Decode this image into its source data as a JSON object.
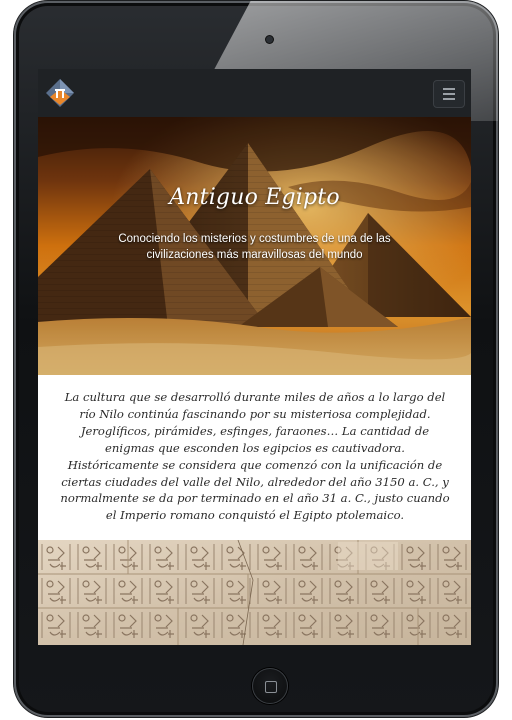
{
  "hero": {
    "title": "Antiguo Egipto",
    "subtitle": "Conociendo los misterios y costumbres de una de las civilizaciones más maravillosas del mundo"
  },
  "intro": {
    "text": "La cultura que se desarrolló durante miles de años a lo largo del río Nilo continúa fascinando por su misteriosa complejidad. Jeroglíficos, pirámides, esfinges, faraones… La cantidad de enigmas que esconden los egipcios es cautivadora. Históricamente se considera que comenzó con la unificación de ciertas ciudades del valle del Nilo, alrededor del año 3150 a. C., y normalmente se da por terminado en el año 31 a. C., justo cuando el Imperio romano conquistó el Egipto ptolemaico."
  },
  "icons": {
    "logo": "pyramid-logo-icon",
    "menu": "hamburger-menu-icon"
  },
  "colors": {
    "navbar": "#1f2225",
    "sky": "#e07a10",
    "logo_accent": "#e8862a"
  }
}
